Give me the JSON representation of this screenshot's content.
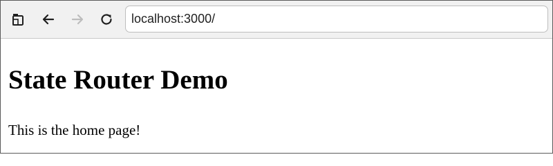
{
  "browser": {
    "address": "localhost:3000/",
    "icons": {
      "tabs": "tab-switcher-icon",
      "back": "back-arrow-icon",
      "forward": "forward-arrow-icon",
      "reload": "reload-icon"
    },
    "forward_enabled": false,
    "colors": {
      "toolbar_bg": "#f1f1f1",
      "icon_active": "#1f1f1f",
      "icon_disabled": "#bdbdbd"
    }
  },
  "page": {
    "heading": "State Router Demo",
    "text": "This is the home page!"
  }
}
